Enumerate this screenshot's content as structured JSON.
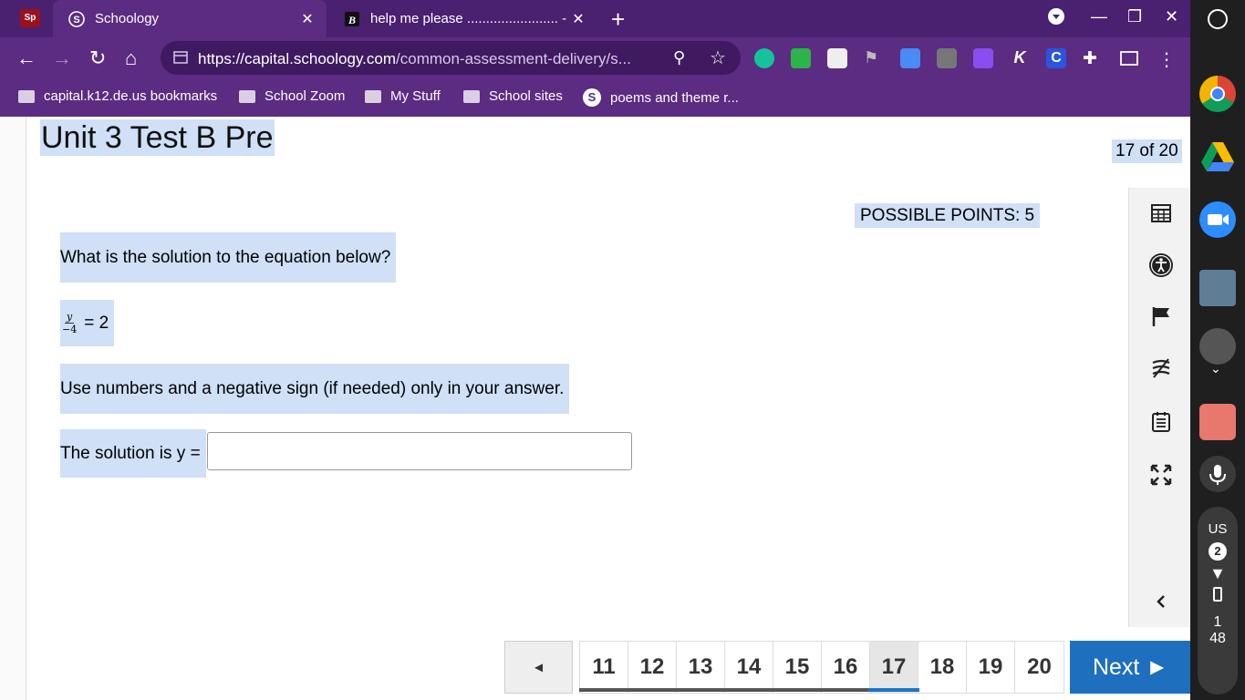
{
  "browser": {
    "tabs": [
      {
        "title": "",
        "favicon": "schoology-sp-icon"
      },
      {
        "title": "Schoology",
        "favicon": "schoology-s-icon",
        "active": true
      },
      {
        "title": "help me please ........................ - B",
        "favicon": "brainly-b-icon"
      }
    ],
    "url_host": "https://capital.schoology.com",
    "url_path": "/common-assessment-delivery/s...",
    "bookmarks": [
      {
        "label": "capital.k12.de.us bookmarks",
        "icon": "folder-icon"
      },
      {
        "label": "School Zoom",
        "icon": "folder-icon"
      },
      {
        "label": "My Stuff",
        "icon": "folder-icon"
      },
      {
        "label": "School sites",
        "icon": "folder-icon"
      },
      {
        "label": "poems and theme r...",
        "icon": "schoology-s-icon"
      }
    ]
  },
  "assessment": {
    "title": "Unit 3 Test B Pre",
    "progress": "17 of 20",
    "points": "POSSIBLE POINTS: 5",
    "prompt": "What is the solution to the equation below?",
    "equation": {
      "numerator": "y",
      "denominator": "−4",
      "rhs": "= 2"
    },
    "instructions": "Use numbers and a negative sign (if needed) only in your answer.",
    "answer_label": "The solution is y =",
    "answer_value": ""
  },
  "pager": {
    "prev_label": "◄",
    "pages": [
      "11",
      "12",
      "13",
      "14",
      "15",
      "16",
      "17",
      "18",
      "19",
      "20"
    ],
    "current": "17",
    "next_label": "Next ►"
  },
  "tools": [
    "calculator-grid-icon",
    "accessibility-icon",
    "flag-icon",
    "line-reader-icon",
    "notepad-icon",
    "fullscreen-icon",
    "collapse-chevron-icon"
  ],
  "system_tray": {
    "locale": "US",
    "notifications": "2",
    "time_hour": "1",
    "time_min": "48"
  },
  "colors": {
    "chrome": "#5b2c82",
    "highlight": "#cfe0f7",
    "next_button": "#1e6fbd"
  }
}
